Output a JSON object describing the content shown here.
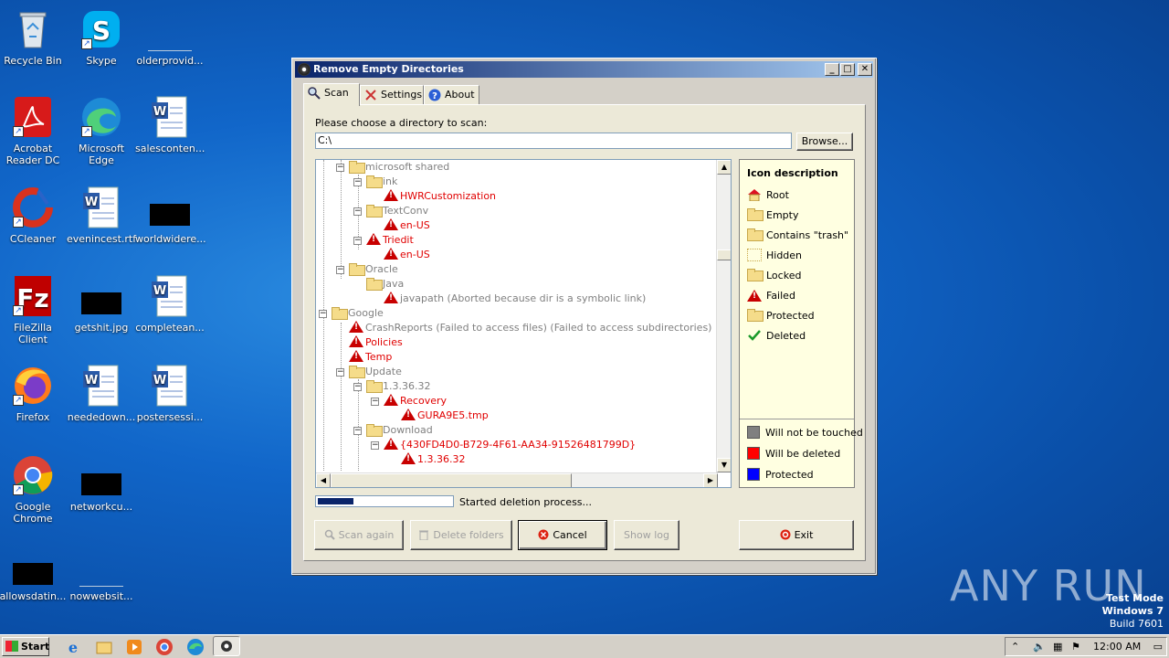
{
  "desktop": {
    "icons": [
      {
        "label": "Recycle Bin"
      },
      {
        "label": "Skype"
      },
      {
        "label": "olderprovid..."
      },
      {
        "label": "Acrobat Reader DC"
      },
      {
        "label": "Microsoft Edge"
      },
      {
        "label": "salesconten..."
      },
      {
        "label": "CCleaner"
      },
      {
        "label": "evenincest.rtf"
      },
      {
        "label": "worldwidere..."
      },
      {
        "label": "FileZilla Client"
      },
      {
        "label": "getshit.jpg"
      },
      {
        "label": "completean..."
      },
      {
        "label": "Firefox"
      },
      {
        "label": "neededown..."
      },
      {
        "label": "postersessi..."
      },
      {
        "label": "Google Chrome"
      },
      {
        "label": "networkcu..."
      },
      {
        "label": "allowsdatin..."
      },
      {
        "label": "nowwebsit..."
      }
    ]
  },
  "window": {
    "title": "Remove Empty Directories",
    "controls": {
      "minimize": "_",
      "maximize": "□",
      "close": "✕"
    },
    "tabs": [
      {
        "label": "Scan"
      },
      {
        "label": "Settings"
      },
      {
        "label": "About"
      }
    ],
    "choose_label": "Please choose a directory to scan:",
    "directory_value": "C:\\",
    "browse_label": "Browse...",
    "tree": [
      {
        "text": "microsoft shared",
        "color": "gray"
      },
      {
        "text": "ink",
        "color": "gray"
      },
      {
        "text": "HWRCustomization",
        "color": "red"
      },
      {
        "text": "TextConv",
        "color": "gray"
      },
      {
        "text": "en-US",
        "color": "red"
      },
      {
        "text": "Triedit",
        "color": "red"
      },
      {
        "text": "en-US",
        "color": "red"
      },
      {
        "text": "Oracle",
        "color": "gray"
      },
      {
        "text": "Java",
        "color": "gray"
      },
      {
        "text": "javapath (Aborted because dir is a symbolic link)",
        "color": "gray"
      },
      {
        "text": "Google",
        "color": "gray"
      },
      {
        "text": "CrashReports (Failed to access files) (Failed to access subdirectories)",
        "color": "gray"
      },
      {
        "text": "Policies",
        "color": "red"
      },
      {
        "text": "Temp",
        "color": "red"
      },
      {
        "text": "Update",
        "color": "gray"
      },
      {
        "text": "1.3.36.32",
        "color": "gray"
      },
      {
        "text": "Recovery",
        "color": "red"
      },
      {
        "text": "GURA9E5.tmp",
        "color": "red"
      },
      {
        "text": "Download",
        "color": "gray"
      },
      {
        "text": "{430FD4D0-B729-4F61-AA34-91526481799D}",
        "color": "red"
      },
      {
        "text": "1.3.36.32",
        "color": "red"
      }
    ],
    "legend": {
      "title": "Icon description",
      "items": [
        {
          "label": "Root",
          "icon": "root-icon"
        },
        {
          "label": "Empty",
          "icon": "folder-icon"
        },
        {
          "label": "Contains \"trash\"",
          "icon": "trash-folder-icon"
        },
        {
          "label": "Hidden",
          "icon": "hidden-folder-icon"
        },
        {
          "label": "Locked",
          "icon": "locked-folder-icon"
        },
        {
          "label": "Failed",
          "icon": "warning-icon"
        },
        {
          "label": "Protected",
          "icon": "protected-folder-icon"
        },
        {
          "label": "Deleted",
          "icon": "checkmark-icon"
        }
      ],
      "colors": [
        {
          "label": "Will not be touched",
          "color": "#808080"
        },
        {
          "label": "Will be deleted",
          "color": "#ff0000"
        },
        {
          "label": "Protected",
          "color": "#0000ff"
        }
      ]
    },
    "progress": {
      "fraction": 0.26
    },
    "status_text": "Started deletion process...",
    "buttons": {
      "scan_again": "Scan again",
      "delete_folders": "Delete folders",
      "cancel": "Cancel",
      "show_log": "Show log",
      "exit": "Exit"
    }
  },
  "taskbar": {
    "start_label": "Start",
    "clock": "12:00 AM"
  },
  "watermark": {
    "line1": "Test Mode",
    "line2": "Windows 7",
    "line3": "Build 7601",
    "brand": "ANY RUN"
  }
}
